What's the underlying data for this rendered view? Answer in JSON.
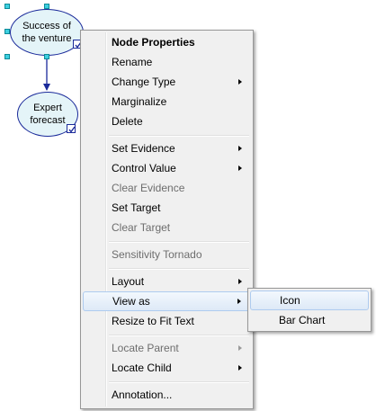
{
  "nodes": [
    {
      "id": "success",
      "label": "Success of\nthe venture"
    },
    {
      "id": "forecast",
      "label": "Expert\nforecast"
    }
  ],
  "context_menu": {
    "items": [
      {
        "label": "Node Properties",
        "bold": true
      },
      {
        "label": "Rename"
      },
      {
        "label": "Change Type",
        "submenu": true
      },
      {
        "label": "Marginalize"
      },
      {
        "label": "Delete"
      },
      {
        "label": "Set Evidence",
        "submenu": true
      },
      {
        "label": "Control Value",
        "submenu": true
      },
      {
        "label": "Clear Evidence",
        "disabled": true
      },
      {
        "label": "Set Target"
      },
      {
        "label": "Clear Target",
        "disabled": true
      },
      {
        "label": "Sensitivity Tornado",
        "disabled": true
      },
      {
        "label": "Layout",
        "submenu": true
      },
      {
        "label": "View as",
        "submenu": true,
        "highlighted": true
      },
      {
        "label": "Resize to Fit Text"
      },
      {
        "label": "Locate Parent",
        "submenu": true,
        "disabled": true
      },
      {
        "label": "Locate Child",
        "submenu": true
      },
      {
        "label": "Annotation..."
      }
    ]
  },
  "view_as_submenu": {
    "items": [
      {
        "label": "Icon",
        "highlighted": true
      },
      {
        "label": "Bar Chart"
      }
    ]
  },
  "colors": {
    "node_fill": "#e4f4f8",
    "node_border": "#1a2a9a",
    "selection_handle": "#3ed0e0",
    "menu_background": "#f0f0f0",
    "menu_highlight": "#dde9f7"
  }
}
